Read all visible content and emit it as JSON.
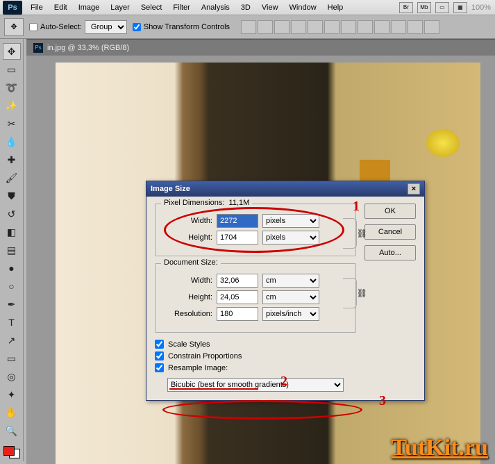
{
  "menubar": {
    "items": [
      "File",
      "Edit",
      "Image",
      "Layer",
      "Select",
      "Filter",
      "Analysis",
      "3D",
      "View",
      "Window",
      "Help"
    ],
    "right_boxes": [
      "Br",
      "Mb"
    ],
    "zoom": "100%"
  },
  "optbar": {
    "auto_select_label": "Auto-Select:",
    "auto_select_value": "Group",
    "show_transform_label": "Show Transform Controls"
  },
  "doc_tab": "in.jpg @ 33,3% (RGB/8)",
  "dialog": {
    "title": "Image Size",
    "pixel_dim_label": "Pixel Dimensions:",
    "pixel_dim_size": "11,1M",
    "width_label": "Width:",
    "height_label": "Height:",
    "px_width": "2272",
    "px_height": "1704",
    "px_unit": "pixels",
    "doc_size_label": "Document Size:",
    "doc_width": "32,06",
    "doc_height": "24,05",
    "doc_unit": "cm",
    "resolution_label": "Resolution:",
    "resolution": "180",
    "resolution_unit": "pixels/inch",
    "scale_styles": "Scale Styles",
    "constrain": "Constrain Proportions",
    "resample_label": "Resample Image:",
    "resample_method": "Bicubic (best for smooth gradients)",
    "ok": "OK",
    "cancel": "Cancel",
    "auto": "Auto..."
  },
  "annotations": {
    "n1": "1",
    "n2": "2",
    "n3": "3"
  },
  "watermark": "TutKit.ru"
}
